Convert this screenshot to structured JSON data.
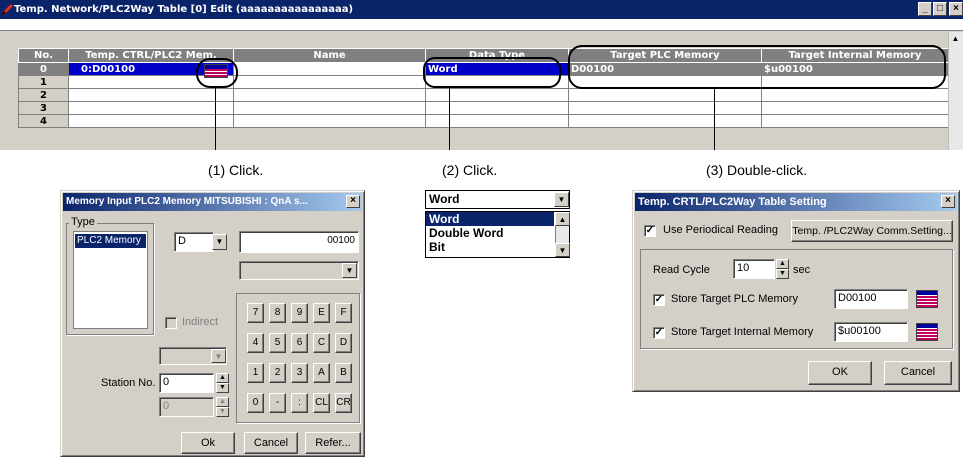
{
  "main_window": {
    "title": "Temp. Network/PLC2Way Table [0] Edit (aaaaaaaaaaaaaaaa)",
    "controls": [
      "_",
      "□",
      "×"
    ],
    "columns": [
      "No.",
      "Temp. CTRL/PLC2 Mem.",
      "Name",
      "Data Type",
      "Target PLC Memory",
      "Target Internal Memory"
    ],
    "rows": [
      {
        "no": "0",
        "mem": "0:D00100",
        "name": "",
        "type": "Word",
        "plc": "D00100",
        "internal": "$u00100"
      },
      {
        "no": "1",
        "mem": "",
        "name": "",
        "type": "",
        "plc": "",
        "internal": ""
      },
      {
        "no": "2",
        "mem": "",
        "name": "",
        "type": "",
        "plc": "",
        "internal": ""
      },
      {
        "no": "3",
        "mem": "",
        "name": "",
        "type": "",
        "plc": "",
        "internal": ""
      },
      {
        "no": "4",
        "mem": "",
        "name": "",
        "type": "",
        "plc": "",
        "internal": ""
      }
    ]
  },
  "captions": {
    "c1": "(1) Click.",
    "c2": "(2) Click.",
    "c3": "(3) Double-click."
  },
  "memory_dialog": {
    "title": "Memory Input  PLC2 Memory MITSUBISHI : QnA s...",
    "type_label": "Type",
    "type_items": [
      "PLC2 Memory"
    ],
    "device": "D",
    "address": "00100",
    "indirect_label": "Indirect",
    "station_label": "Station No.",
    "station_value": "0",
    "station_value2": "0",
    "keys": [
      "7",
      "8",
      "9",
      "E",
      "F",
      "4",
      "5",
      "6",
      "C",
      "D",
      "1",
      "2",
      "3",
      "A",
      "B",
      "0",
      "-",
      ":",
      "CL",
      "CR"
    ],
    "ok": "Ok",
    "cancel": "Cancel",
    "refer": "Refer..."
  },
  "type_dropdown": {
    "selected": "Word",
    "options": [
      "Word",
      "Double Word",
      "Bit"
    ]
  },
  "setting_dialog": {
    "title": "Temp. CRTL/PLC2Way Table Setting",
    "periodical_label": "Use Periodical Reading",
    "comm_button": "Temp. /PLC2Way Comm.Setting...",
    "read_cycle_label": "Read Cycle",
    "read_cycle_value": "10",
    "sec_label": "sec",
    "store_plc_label": "Store Target PLC Memory",
    "store_plc_value": "D00100",
    "store_internal_label": "Store Target Internal Memory",
    "store_internal_value": "$u00100",
    "ok": "OK",
    "cancel": "Cancel"
  },
  "colors": {
    "title_bar": "#0a246a",
    "selection_blue": "#0000c8",
    "header_gray": "#808080"
  }
}
